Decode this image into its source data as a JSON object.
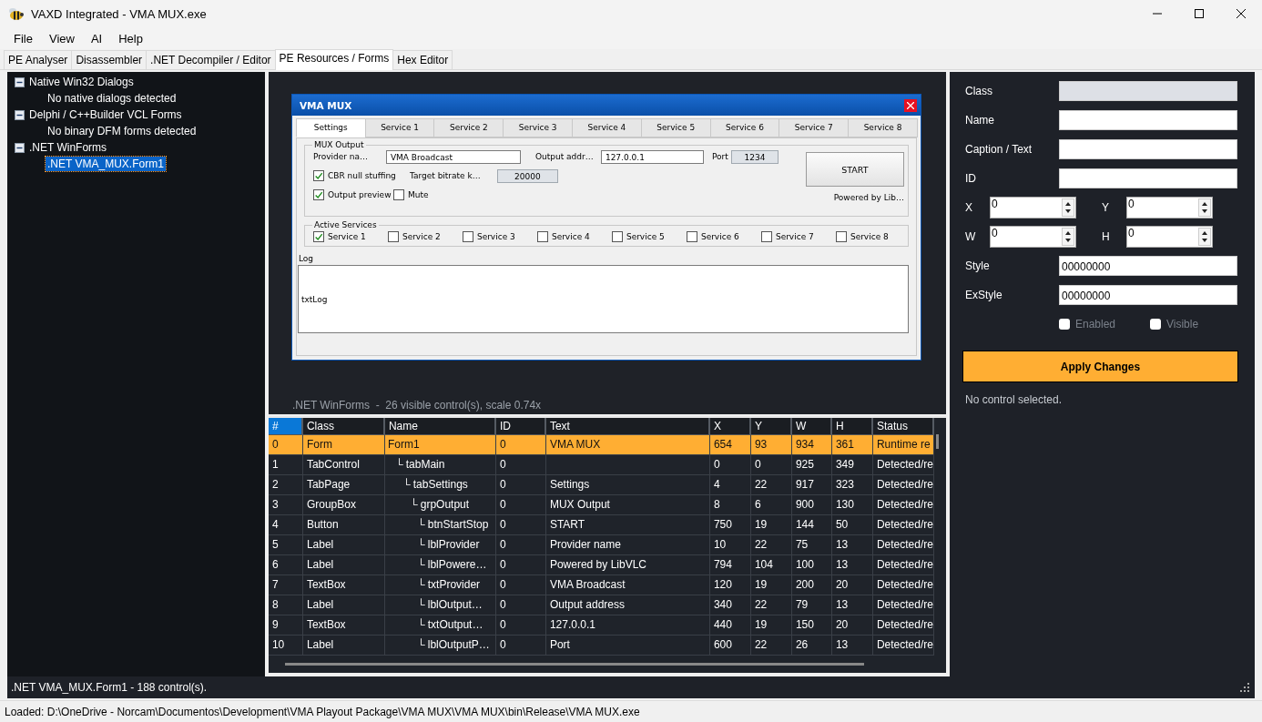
{
  "window": {
    "title": "VAXD Integrated - VMA MUX.exe"
  },
  "menu": [
    "File",
    "View",
    "AI",
    "Help"
  ],
  "tabs": [
    {
      "label": "PE Analyser",
      "selected": false
    },
    {
      "label": "Disassembler",
      "selected": false
    },
    {
      "label": ".NET Decompiler / Editor",
      "selected": false
    },
    {
      "label": "PE Resources / Forms",
      "selected": true
    },
    {
      "label": "Hex Editor",
      "selected": false
    }
  ],
  "tree": [
    {
      "label": "Native Win32 Dialogs",
      "expanded": true,
      "children": [
        {
          "label": "No native dialogs detected",
          "selected": false
        }
      ]
    },
    {
      "label": "Delphi / C++Builder VCL Forms",
      "expanded": true,
      "children": [
        {
          "label": "No binary DFM forms detected",
          "selected": false
        }
      ]
    },
    {
      "label": ".NET WinForms",
      "expanded": true,
      "children": [
        {
          "label": ".NET VMA_MUX.Form1",
          "selected": true
        }
      ]
    }
  ],
  "preview": {
    "form": {
      "title": "VMA MUX",
      "tabs": [
        {
          "label": "Settings",
          "selected": true
        },
        {
          "label": "Service 1",
          "selected": false
        },
        {
          "label": "Service 2",
          "selected": false
        },
        {
          "label": "Service 3",
          "selected": false
        },
        {
          "label": "Service 4",
          "selected": false
        },
        {
          "label": "Service 5",
          "selected": false
        },
        {
          "label": "Service 6",
          "selected": false
        },
        {
          "label": "Service 7",
          "selected": false
        },
        {
          "label": "Service 8",
          "selected": false
        }
      ],
      "mux_output": {
        "title": "MUX Output",
        "provider_label": "Provider na…",
        "provider_value": "VMA Broadcast",
        "address_label": "Output addr…",
        "address_value": "127.0.0.1",
        "port_label": "Port",
        "port_value": "1234",
        "start_button": "START",
        "cbr": {
          "label": "CBR null stuffing",
          "checked": true
        },
        "bitrate_label": "Target bitrate k…",
        "bitrate_value": "20000",
        "output_preview": {
          "label": "Output preview",
          "checked": true
        },
        "mute": {
          "label": "Mute",
          "checked": false
        },
        "powered_by": "Powered by Lib…"
      },
      "active_services": {
        "title": "Active Services",
        "services": [
          {
            "label": "Service 1",
            "checked": true
          },
          {
            "label": "Service 2",
            "checked": false
          },
          {
            "label": "Service 3",
            "checked": false
          },
          {
            "label": "Service 4",
            "checked": false
          },
          {
            "label": "Service 5",
            "checked": false
          },
          {
            "label": "Service 6",
            "checked": false
          },
          {
            "label": "Service 7",
            "checked": false
          },
          {
            "label": "Service 8",
            "checked": false
          }
        ]
      },
      "log": {
        "label": "Log",
        "text": "txtLog"
      }
    },
    "caption": ".NET WinForms  -  26 visible control(s), scale 0.74x"
  },
  "table": {
    "columns": [
      {
        "label": "#",
        "selected": true
      },
      {
        "label": "Class",
        "selected": false
      },
      {
        "label": "Name",
        "selected": false
      },
      {
        "label": "ID",
        "selected": false
      },
      {
        "label": "Text",
        "selected": false
      },
      {
        "label": "X",
        "selected": false
      },
      {
        "label": "Y",
        "selected": false
      },
      {
        "label": "W",
        "selected": false
      },
      {
        "label": "H",
        "selected": false
      },
      {
        "label": "Status",
        "selected": false
      }
    ],
    "rows": [
      {
        "cells": [
          "0",
          "Form",
          "Form1",
          "0",
          "VMA MUX",
          "654",
          "93",
          "934",
          "361",
          "Runtime re"
        ],
        "selected": true,
        "children": [
          {
            "cells": [
              "1",
              "TabControl",
              "└ tabMain",
              "0",
              "",
              "0",
              "0",
              "925",
              "349",
              "Detected/re"
            ],
            "selected": false,
            "children": [
              {
                "cells": [
                  "2",
                  "TabPage",
                  "└ tabSettings",
                  "0",
                  "Settings",
                  "4",
                  "22",
                  "917",
                  "323",
                  "Detected/re"
                ],
                "selected": false,
                "children": [
                  {
                    "cells": [
                      "3",
                      "GroupBox",
                      "└ grpOutput",
                      "0",
                      "MUX Output",
                      "8",
                      "6",
                      "900",
                      "130",
                      "Detected/re"
                    ],
                    "selected": false,
                    "children": [
                      {
                        "cells": [
                          "4",
                          "Button",
                          "└ btnStartStop",
                          "0",
                          "START",
                          "750",
                          "19",
                          "144",
                          "50",
                          "Detected/re"
                        ],
                        "selected": false
                      },
                      {
                        "cells": [
                          "5",
                          "Label",
                          "└ lblProvider",
                          "0",
                          "Provider name",
                          "10",
                          "22",
                          "75",
                          "13",
                          "Detected/re"
                        ],
                        "selected": false
                      },
                      {
                        "cells": [
                          "6",
                          "Label",
                          "└ lblPowere…",
                          "0",
                          "Powered by LibVLC",
                          "794",
                          "104",
                          "100",
                          "13",
                          "Detected/re"
                        ],
                        "selected": false
                      },
                      {
                        "cells": [
                          "7",
                          "TextBox",
                          "└ txtProvider",
                          "0",
                          "VMA Broadcast",
                          "120",
                          "19",
                          "200",
                          "20",
                          "Detected/re"
                        ],
                        "selected": false
                      },
                      {
                        "cells": [
                          "8",
                          "Label",
                          "└ lblOutput…",
                          "0",
                          "Output address",
                          "340",
                          "22",
                          "79",
                          "13",
                          "Detected/re"
                        ],
                        "selected": false
                      },
                      {
                        "cells": [
                          "9",
                          "TextBox",
                          "└ txtOutput…",
                          "0",
                          "127.0.0.1",
                          "440",
                          "19",
                          "150",
                          "20",
                          "Detected/re"
                        ],
                        "selected": false
                      },
                      {
                        "cells": [
                          "10",
                          "Label",
                          "└ lblOutputP…",
                          "0",
                          "Port",
                          "600",
                          "22",
                          "26",
                          "13",
                          "Detected/re"
                        ],
                        "selected": false
                      }
                    ]
                  }
                ]
              }
            ]
          }
        ]
      }
    ]
  },
  "properties": {
    "fields": [
      {
        "kind": "text",
        "label": "Class",
        "disabled": true
      },
      {
        "kind": "text",
        "label": "Name",
        "disabled": false
      },
      {
        "kind": "text",
        "label": "Caption / Text",
        "disabled": false
      },
      {
        "kind": "text",
        "label": "ID",
        "disabled": false
      },
      {
        "kind": "spin-pair",
        "items": [
          {
            "label": "X",
            "value": "0"
          },
          {
            "label": "Y",
            "value": "0"
          }
        ]
      },
      {
        "kind": "spin-pair",
        "items": [
          {
            "label": "W",
            "value": "0"
          },
          {
            "label": "H",
            "value": "0"
          }
        ]
      },
      {
        "kind": "text",
        "label": "Style",
        "value": "00000000",
        "disabled": false
      },
      {
        "kind": "text",
        "label": "ExStyle",
        "value": "00000000",
        "disabled": false
      }
    ],
    "checkboxes": [
      {
        "label": "Enabled",
        "checked": false,
        "disabled": true
      },
      {
        "label": "Visible",
        "checked": false,
        "disabled": true
      }
    ],
    "apply_button": "Apply Changes",
    "message": "No control selected."
  },
  "summary": ".NET VMA_MUX.Form1 - 188 control(s).",
  "status_bar": "Loaded: D:\\OneDrive - Norcam\\Documentos\\Development\\VMA Playout Package\\VMA MUX\\VMA MUX\\bin\\Release\\VMA MUX.exe"
}
